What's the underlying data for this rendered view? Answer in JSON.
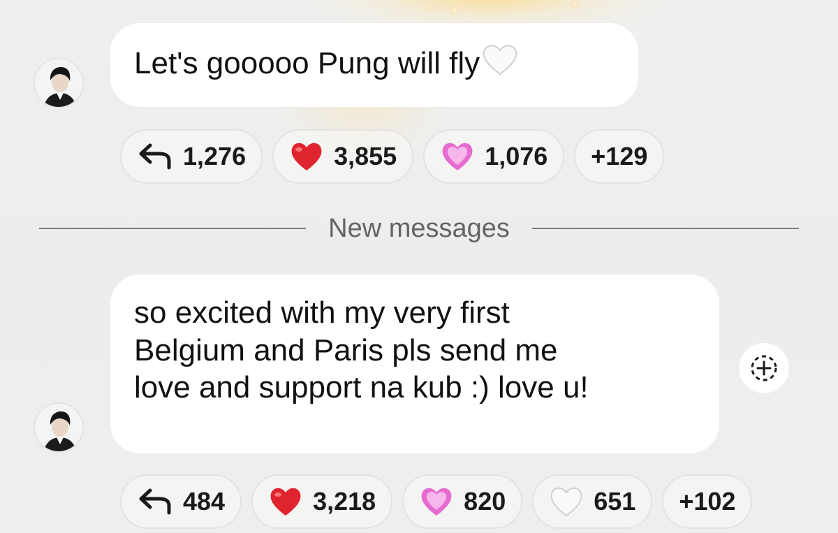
{
  "messages": [
    {
      "text": "Let's gooooo Pung will fly",
      "text_emoji": "white-heart-emoji",
      "reactions": [
        {
          "icon": "reply-arrow-icon",
          "count": "1,276"
        },
        {
          "icon": "red-heart-emoji",
          "count": "3,855"
        },
        {
          "icon": "pink-heart-emoji",
          "count": "1,076"
        },
        {
          "icon": "",
          "count": "+129"
        }
      ]
    },
    {
      "lines": [
        "so excited with my very first",
        "Belgium and Paris pls send me",
        "love and support na kub :) love u!"
      ],
      "reactions": [
        {
          "icon": "reply-arrow-icon",
          "count": "484"
        },
        {
          "icon": "red-heart-emoji",
          "count": "3,218"
        },
        {
          "icon": "pink-heart-emoji",
          "count": "820"
        },
        {
          "icon": "white-heart-emoji",
          "count": "651"
        },
        {
          "icon": "",
          "count": "+102"
        }
      ]
    }
  ],
  "divider": {
    "label": "New messages"
  },
  "colors": {
    "bubble": "#ffffff",
    "background": "#eeeeec",
    "red_heart": "#e0242f",
    "pink_heart": "#e66bd0",
    "divider_text": "#646464"
  }
}
